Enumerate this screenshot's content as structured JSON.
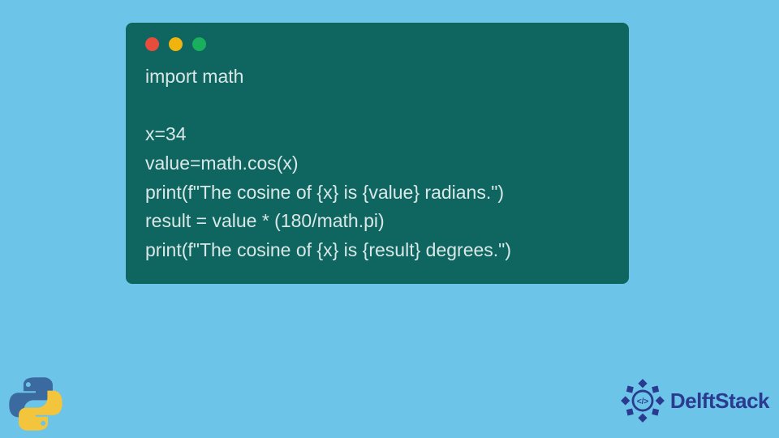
{
  "window": {
    "dot_red": "red",
    "dot_amber": "amber",
    "dot_green": "green"
  },
  "code": {
    "line1": "import math",
    "line2": "",
    "line3": "x=34",
    "line4": "value=math.cos(x)",
    "line5": "print(f\"The cosine of {x} is {value} radians.\")",
    "line6": "result = value * (180/math.pi)",
    "line7": "print(f\"The cosine of {x} is {result} degrees.\")"
  },
  "logos": {
    "python_name": "python-icon",
    "delft_label": "DelftStack"
  }
}
